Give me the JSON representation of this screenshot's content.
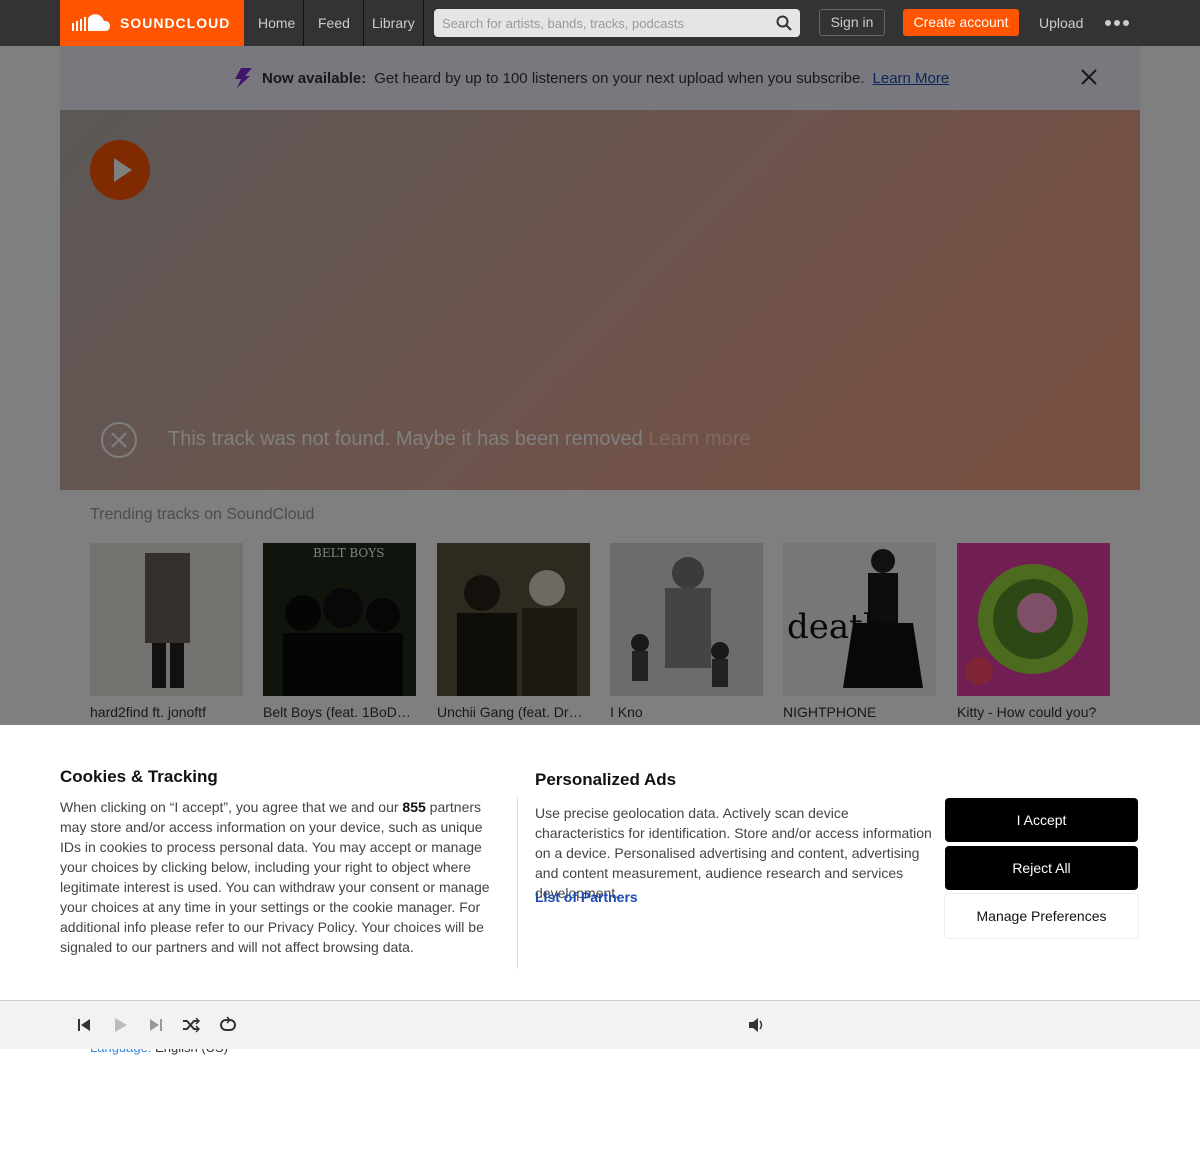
{
  "header": {
    "logo_text": "SOUNDCLOUD",
    "nav": {
      "home": "Home",
      "feed": "Feed",
      "library": "Library"
    },
    "search_placeholder": "Search for artists, bands, tracks, podcasts",
    "sign_in": "Sign in",
    "create_account": "Create account",
    "upload": "Upload"
  },
  "banner": {
    "title": "Now available:",
    "text": "Get heard by up to 100 listeners on your next upload when you subscribe.",
    "link": "Learn More"
  },
  "hero": {
    "error_text": "This track was not found. Maybe it has been removed",
    "error_link": "Learn more"
  },
  "trending": {
    "title": "Trending tracks on SoundCloud",
    "tracks": [
      {
        "label": "hard2find ft. jonoftf",
        "art": "#6b6159"
      },
      {
        "label": "Belt Boys (feat. 1BoDea...",
        "art": "#1f2b1a"
      },
      {
        "label": "Unchii Gang (feat. DreLu)",
        "art": "#5a5441"
      },
      {
        "label": "I Kno",
        "art": "#d9d9d9"
      },
      {
        "label": "NIGHTPHONE",
        "art": "#efefef"
      },
      {
        "label": "Kitty - How could you?",
        "art": "#e23fa4"
      }
    ],
    "art_captions": {
      "belt_boys": "BELT BOYS",
      "nightphone": "death"
    }
  },
  "footer": {
    "language_key": "Language:",
    "language_value": "English (US)"
  },
  "cookie": {
    "title": "Cookies & Tracking",
    "body_pre": "When clicking on “I accept”, you agree that we and our ",
    "partners_count": "855",
    "body_post": " partners may store and/or access information on your device, such as unique IDs in cookies to process personal data. You may accept or manage your choices by clicking below, including your right to object where legitimate interest is used. You can withdraw your consent or manage your choices at any time in your settings or the cookie manager. For additional info please refer to our Privacy Policy. Your choices will be signaled to our partners and will not affect browsing data.",
    "ads_title": "Personalized Ads",
    "ads_body": "Use precise geolocation data. Actively scan device characteristics for identification. Store and/or access information on a device. Personalised advertising and content, advertising and content measurement, audience research and services development.",
    "partners_link": "List of Partners",
    "accept": "I Accept",
    "reject": "Reject All",
    "manage": "Manage Preferences"
  },
  "colors": {
    "brand": "#ff5500",
    "link": "#1b4bb3",
    "banner_icon": "#7d2ed6"
  },
  "icons": [
    "soundcloud-logo-icon",
    "search-icon",
    "more-icon",
    "bolt-icon",
    "close-icon",
    "play-icon",
    "error-x-icon",
    "previous-icon",
    "next-icon",
    "shuffle-icon",
    "repeat-icon",
    "volume-icon"
  ]
}
